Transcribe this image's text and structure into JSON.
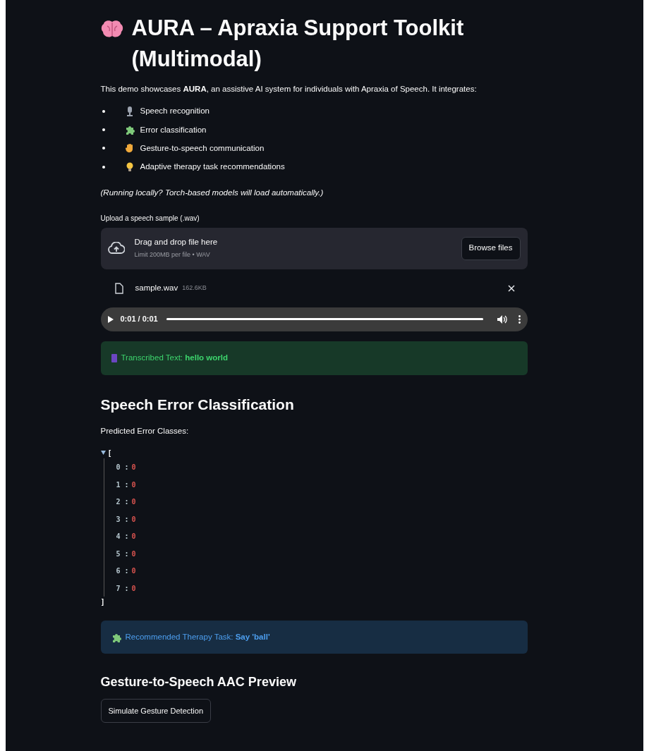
{
  "title": "AURA – Apraxia Support Toolkit (Multimodal)",
  "intro": "This demo showcases **AURA**, an assistive AI system for individuals with Apraxia of Speech. It integrates:",
  "features": [
    {
      "kind": "mic",
      "label": "Speech recognition"
    },
    {
      "kind": "puzzle",
      "label": "Error classification"
    },
    {
      "kind": "hand",
      "label": "Gesture-to-speech communication"
    },
    {
      "kind": "bulb",
      "label": "Adaptive therapy task recommendations"
    }
  ],
  "note": "(Running locally? Torch-based models will load automatically.)",
  "uploader": {
    "label": "Upload a speech sample (.wav)",
    "drop_text": "Drag and drop file here",
    "limit": "Limit 200MB per file • WAV",
    "button": "Browse files"
  },
  "file": {
    "name": "sample.wav",
    "size": "162.6KB"
  },
  "audio": {
    "time": "0:01 / 0:01",
    "level": 1
  },
  "success": {
    "text": "Transcribed Text: **hello world**"
  },
  "classification": {
    "heading": "Speech Error Classification",
    "label": "Predicted Error Classes:",
    "json_view": {
      "expanded": true,
      "open": "[",
      "close": "]",
      "items": [
        {
          "key": "0 :",
          "value": "0"
        },
        {
          "key": "1 :",
          "value": "0"
        },
        {
          "key": "2 :",
          "value": "0"
        },
        {
          "key": "3 :",
          "value": "0"
        },
        {
          "key": "4 :",
          "value": "0"
        },
        {
          "key": "5 :",
          "value": "0"
        },
        {
          "key": "6 :",
          "value": "0"
        },
        {
          "key": "7 :",
          "value": "0"
        }
      ]
    }
  },
  "info": {
    "text": "Recommended Therapy Task: **Say 'ball'**"
  },
  "gesture": {
    "heading": "Gesture-to-Speech AAC Preview",
    "button": "Simulate Gesture Detection"
  }
}
